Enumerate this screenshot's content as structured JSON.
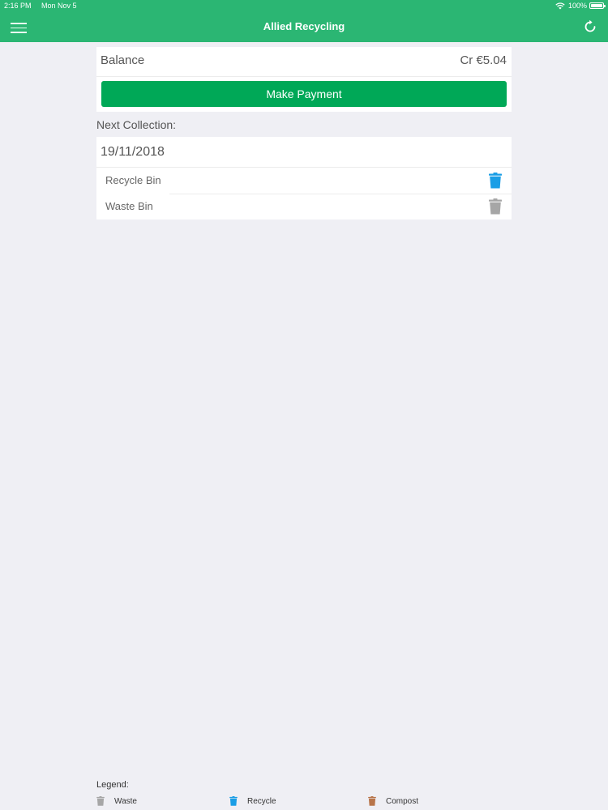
{
  "status_bar": {
    "time": "2:16 PM",
    "date": "Mon Nov 5",
    "battery": "100%"
  },
  "nav": {
    "title": "Allied Recycling",
    "menu_icon": "hamburger-menu-icon",
    "refresh_icon": "refresh-icon"
  },
  "balance": {
    "label": "Balance",
    "value": "Cr €5.04",
    "button_label": "Make Payment"
  },
  "collection": {
    "heading": "Next Collection:",
    "date": "19/11/2018",
    "bins": [
      {
        "label": "Recycle Bin",
        "icon": "trash-bin-icon",
        "color": "#1a9ee6"
      },
      {
        "label": "Waste Bin",
        "icon": "trash-bin-icon",
        "color": "#a6a6a6"
      }
    ]
  },
  "legend": {
    "title": "Legend:",
    "items": [
      {
        "label": "Waste",
        "color": "#a6a6a6"
      },
      {
        "label": "Recycle",
        "color": "#1a9ee6"
      },
      {
        "label": "Compost",
        "color": "#b8754a"
      }
    ]
  },
  "colors": {
    "brand": "#2bb673",
    "button": "#00a857",
    "background": "#efeff4"
  }
}
